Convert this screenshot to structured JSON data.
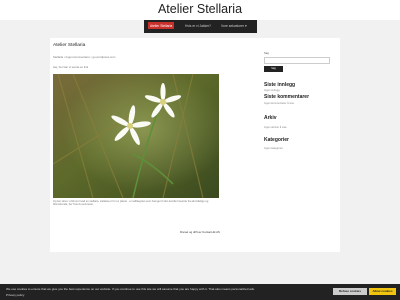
{
  "site": {
    "title": "Atelier Stellaria"
  },
  "nav": {
    "items": [
      {
        "label": "Atelier Stellaria"
      },
      {
        "label": "Hvis er vi Jakker?"
      },
      {
        "label": "Vore sekvatorer"
      }
    ]
  },
  "post": {
    "title": "Atelier Stellaria",
    "meta": "Stellaria • Ingen kommentarer • go.wordpress.com",
    "meta2": "Hej, her kan vi sende en link",
    "caption": "Og her skrev vi lidt om hvad en stellaria, stellaria er for en plante - et nellikegræs som hænger til den kendte havetræ fra almindelige og blomstrende, her hvis du selv laver."
  },
  "sidebar": {
    "search_label": "Søg",
    "search_button": "Søg",
    "recent_posts_title": "Siste innlegg",
    "recent_posts_text": "Ingen innlegg",
    "recent_comments_title": "Siste kommentarer",
    "recent_comments_text": "Ingen kommentarer å vise.",
    "archive_title": "Arkiv",
    "archive_text": "Ingen arkiver å vise.",
    "categories_title": "Kategorier",
    "categories_text": "Ingen kategorier"
  },
  "footer": {
    "credit": "Drevet og drift av Contact.dk AS"
  },
  "cookie": {
    "text": "We use cookies to ensure that we give you the best experience on our website. If you continue to use this site we will assume that you are happy with it. That also means personalized ads.",
    "privacy": "Privacy policy",
    "settings_button": "Refuse cookies",
    "accept_button": "Allow cookies"
  }
}
